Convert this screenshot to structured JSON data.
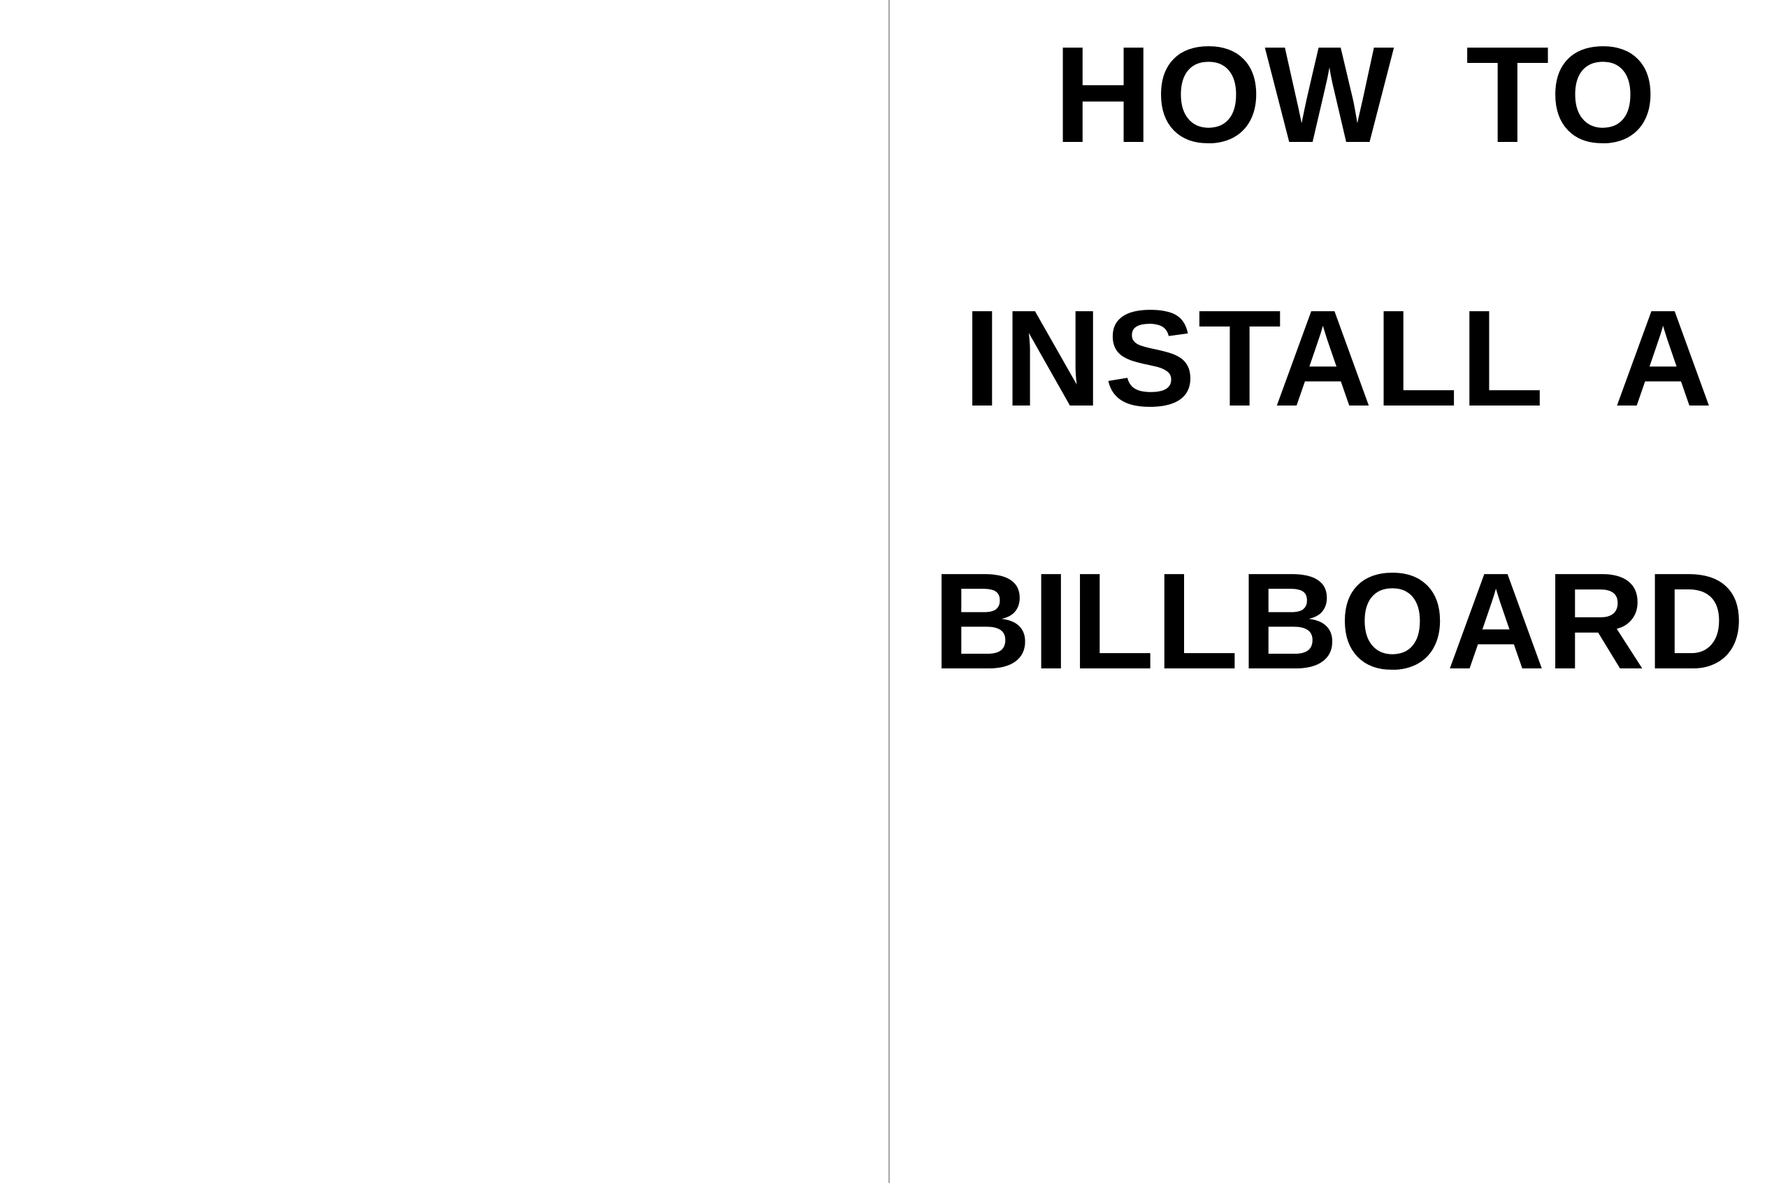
{
  "spread": {
    "left_page": {},
    "right_page": {
      "title_lines": [
        "HOW TO",
        "INSTALL A",
        "BILLBOARD"
      ]
    }
  },
  "colors": {
    "background": "#ffffff",
    "text": "#000000",
    "divider": "#a6a6a6"
  }
}
